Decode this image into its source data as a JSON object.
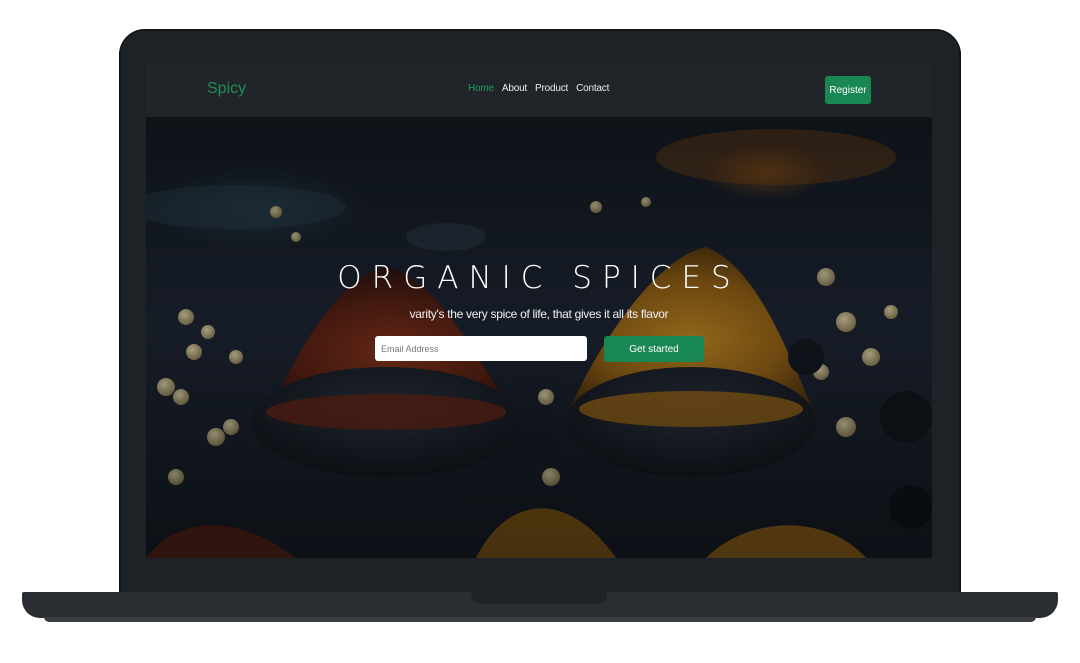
{
  "navbar": {
    "brand": "Spicy",
    "links": [
      {
        "label": "Home",
        "active": true
      },
      {
        "label": "About",
        "active": false
      },
      {
        "label": "Product",
        "active": false
      },
      {
        "label": "Contact",
        "active": false
      }
    ],
    "register_label": "Register"
  },
  "hero": {
    "title": "ORGANIC SPICES",
    "subtitle": "varity's the very spice of life, that gives it all its flavor",
    "email_placeholder": "Email Address",
    "cta_label": "Get started",
    "image_description_icon": "spices-photo"
  },
  "colors": {
    "accent": "#198754",
    "brand_text": "#1f8f55",
    "navbar_bg": "#212529",
    "laptop_frame": "#1d2227"
  }
}
